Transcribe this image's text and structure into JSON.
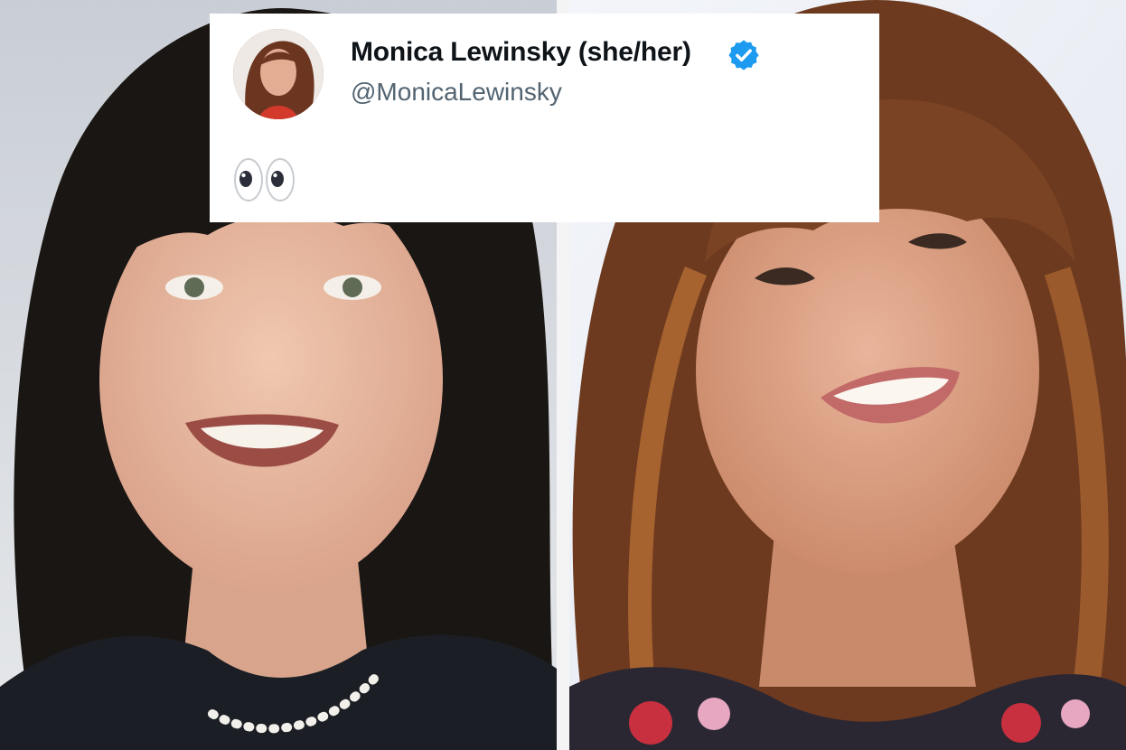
{
  "tweet": {
    "display_name": "Monica Lewinsky (she/her)",
    "handle": "@MonicaLewinsky",
    "body_emoji": "👀",
    "verified": true,
    "badge_icon": "verified-badge-icon",
    "badge_color": "#1d9bf0"
  },
  "colors": {
    "card_background": "#ffffff",
    "name_color": "#0f1419",
    "handle_color": "#536471"
  }
}
